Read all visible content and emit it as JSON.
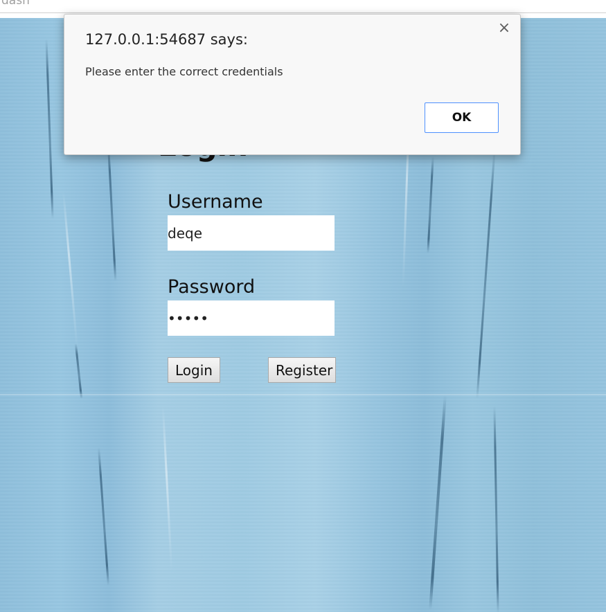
{
  "browser": {
    "tab_title": "dash"
  },
  "page": {
    "heading": "Login",
    "username": {
      "label": "Username",
      "value": "deqe"
    },
    "password": {
      "label": "Password",
      "masked_value": "•••••"
    },
    "buttons": {
      "login": "Login",
      "register": "Register"
    },
    "background": "blue-ice-texture"
  },
  "dialog": {
    "title": "127.0.0.1:54687 says:",
    "message": "Please enter the correct credentials",
    "ok_label": "OK",
    "close_icon": "close-icon",
    "accent_color": "#4d90fe"
  }
}
